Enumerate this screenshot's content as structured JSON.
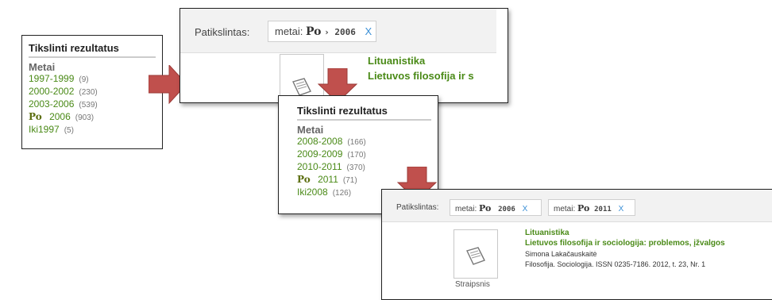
{
  "refine1": {
    "title": "Tikslinti rezultatus",
    "group": "Metai",
    "items": [
      {
        "label": "1997-1999",
        "count": "(9)"
      },
      {
        "label": "2000-2002",
        "count": "(230)"
      },
      {
        "label": "2003-2006",
        "count": "(539)"
      },
      {
        "po": "Po",
        "label": "2006",
        "count": "(903)"
      },
      {
        "label": "Iki1997",
        "count": "(5)"
      }
    ]
  },
  "result1": {
    "filter_label": "Patikslintas:",
    "chip": {
      "key": "metai:",
      "po": "Po",
      "value": "› 2006",
      "close": "X"
    },
    "title_line1": "Lituanistika",
    "title_line2": "Lietuvos filosofija ir s"
  },
  "refine2": {
    "title": "Tikslinti rezultatus",
    "group": "Metai",
    "items": [
      {
        "label": "2008-2008",
        "count": "(166)"
      },
      {
        "label": "2009-2009",
        "count": "(170)"
      },
      {
        "label": "2010-2011",
        "count": "(370)"
      },
      {
        "po": "Po",
        "label": "2011",
        "count": "(71)"
      },
      {
        "label": "Iki2008",
        "count": "(126)"
      }
    ]
  },
  "result2": {
    "filter_label": "Patikslintas:",
    "chips": [
      {
        "key": "metai:",
        "po": "Po",
        "value": "2006",
        "close": "X"
      },
      {
        "key": "metai:",
        "po": "Po",
        "value": "2011",
        "close": "X"
      }
    ],
    "title_line1": "Lituanistika",
    "title_line2": "Lietuvos filosofija ir sociologija: problemos, įžvalgos",
    "author": "Simona Lakačauskaitė",
    "source": "Filosofija. Sociologija. ISSN 0235-7186. 2012, t. 23, Nr. 1",
    "type_label": "Straipsnis"
  },
  "colors": {
    "link_green": "#4a8a17",
    "arrow_red": "#c0504d",
    "close_blue": "#3a8fd6"
  }
}
